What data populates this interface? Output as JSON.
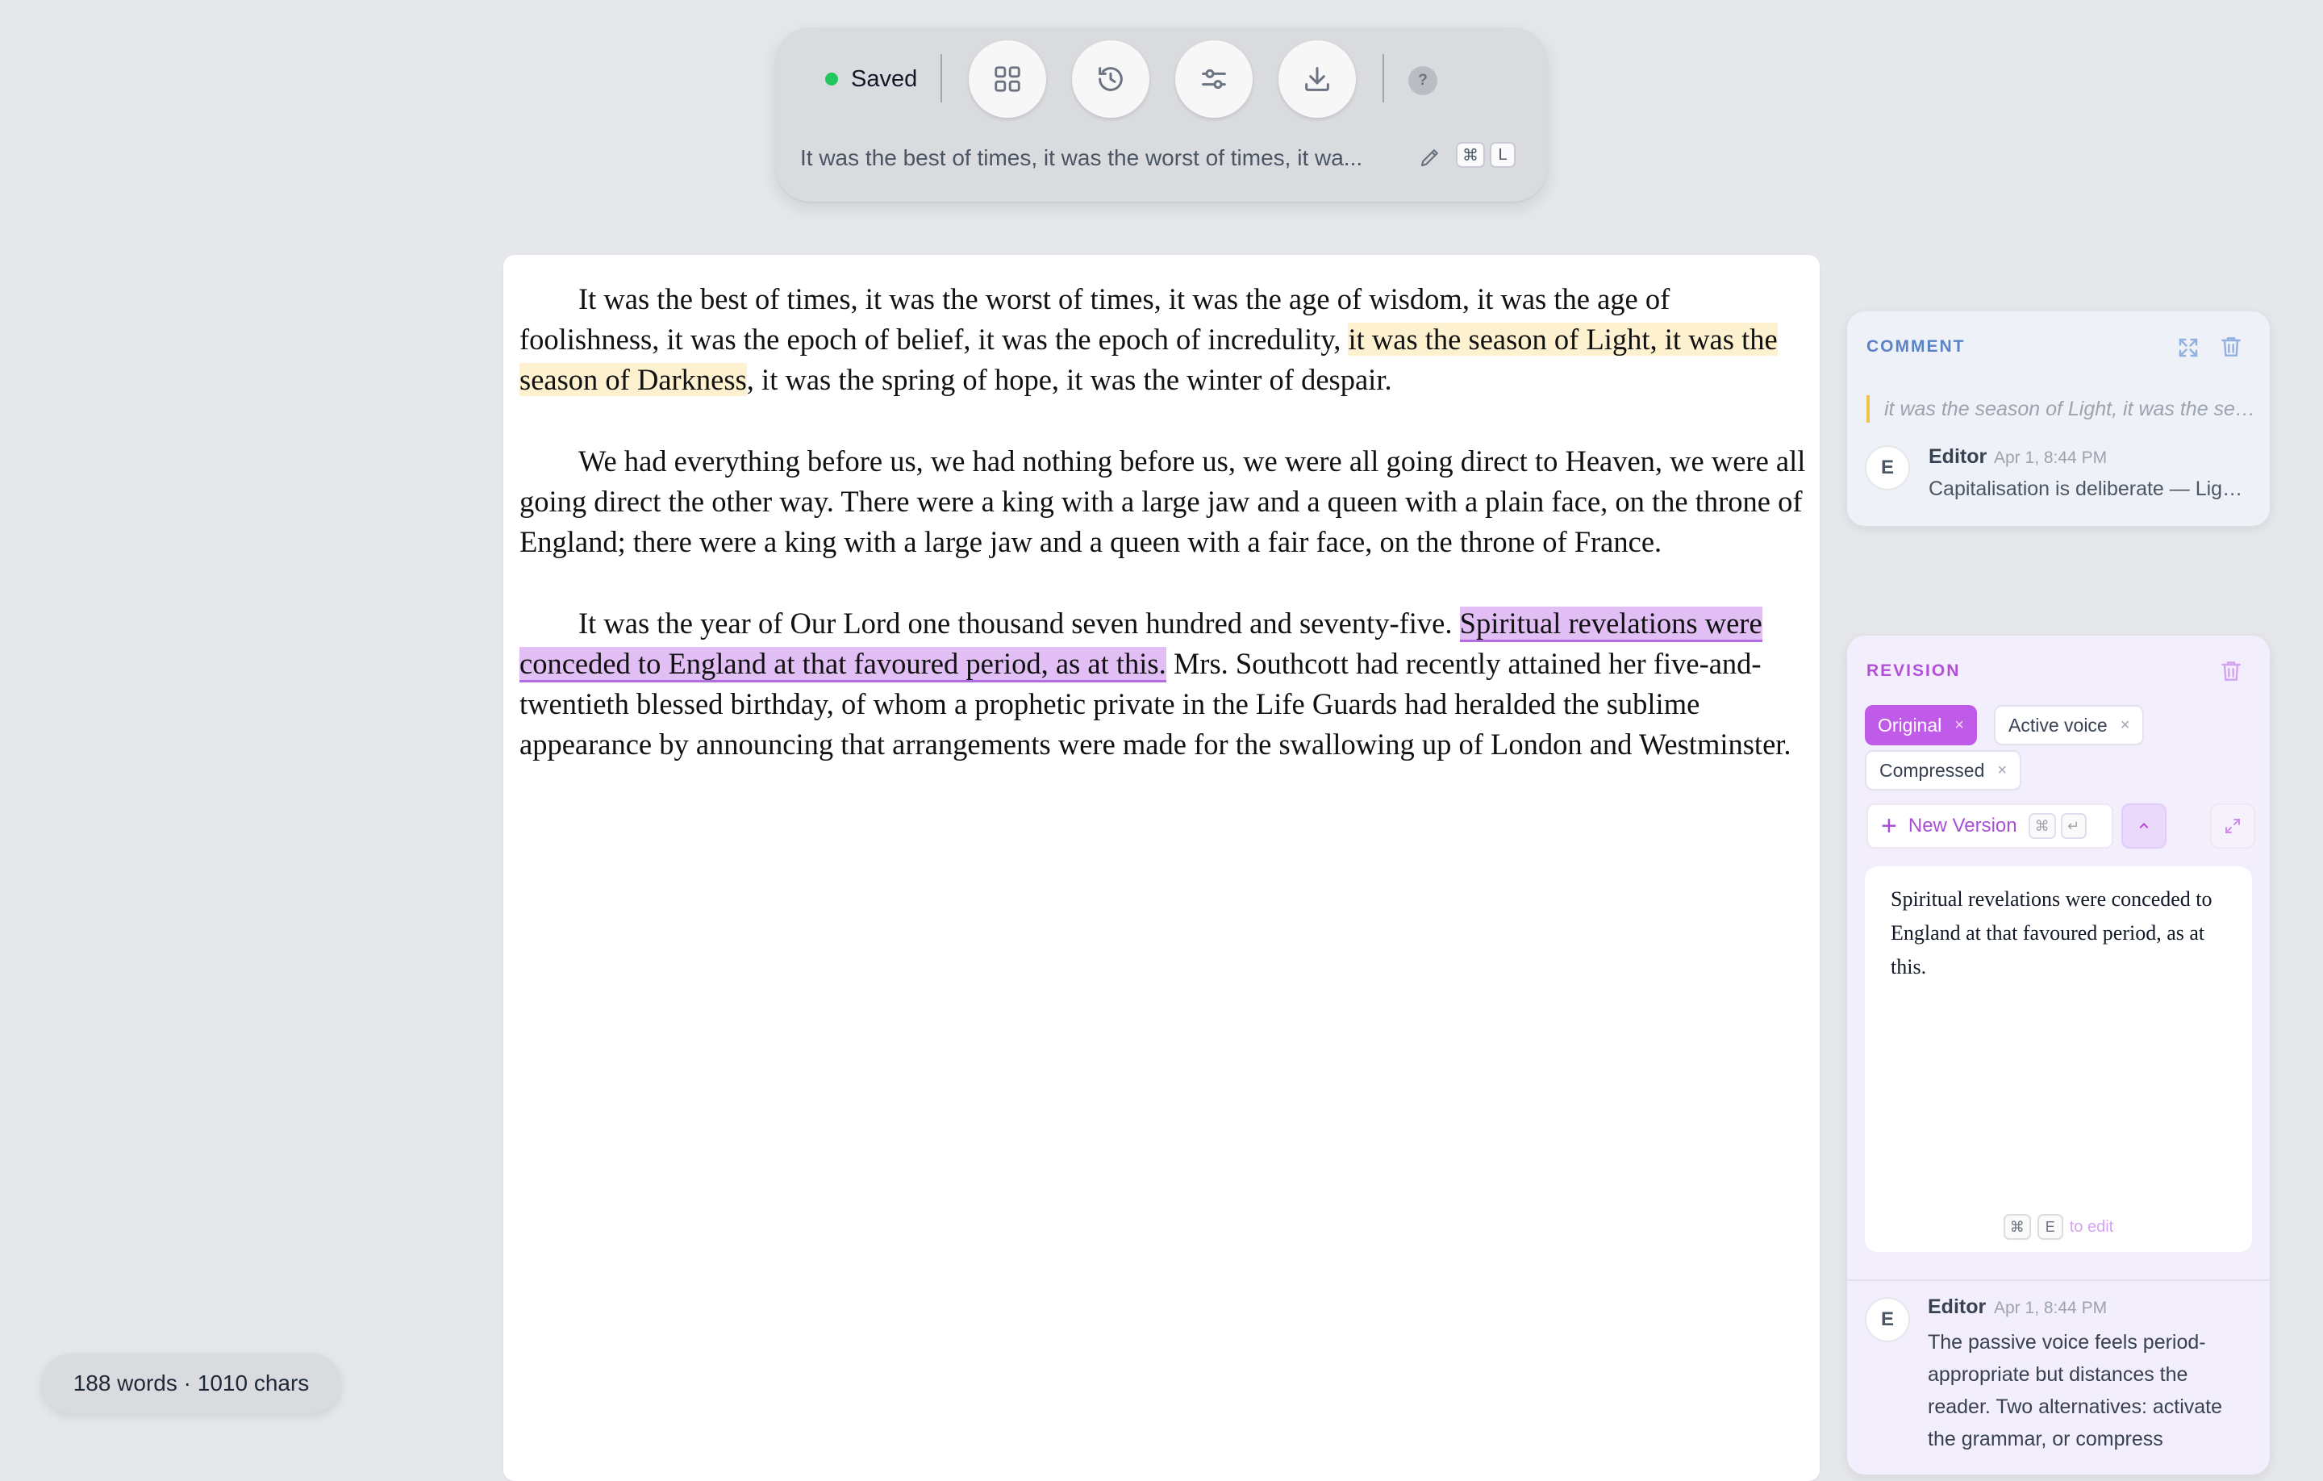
{
  "toolbar": {
    "saved_label": "Saved",
    "doc_title": "It was the best of times, it was the worst of times, it wa...",
    "help_label": "?",
    "shortcut_keys": [
      "⌘",
      "L"
    ],
    "buttons": [
      "grid-icon",
      "history-icon",
      "sliders-icon",
      "download-icon"
    ]
  },
  "document": {
    "p1_a": "It was the best of times, it was the worst of times, it was the age of wisdom, it was the age of foolishness, it was the epoch of belief, it was the epoch of incredulity, ",
    "p1_highlight": "it was the season of Light, it was the season of Darkness",
    "p1_b": ", it was the spring of hope, it was the winter of despair.",
    "p2": "We had everything before us, we had nothing before us, we were all going direct to Heaven, we were all going direct the other way. There were a king with a large jaw and a queen with a plain face, on the throne of England; there were a king with a large jaw and a queen with a fair face, on the throne of France.",
    "p3_a": "It was the year of Our Lord one thousand seven hundred and seventy-five. ",
    "p3_highlight": "Spiritual revelations were conceded to England at that favoured period, as at this.",
    "p3_b": " Mrs. Southcott had recently attained her five-and-twentieth blessed birthday, of whom a prophetic private in the Life Guards had heralded the sublime appearance by announcing that arrangements were made for the swallowing up of London and Westminster."
  },
  "status": {
    "word_count": "188 words · 1010 chars"
  },
  "comment": {
    "heading": "COMMENT",
    "quote": "it was the season of Light, it was the season of Darkness",
    "avatar": "E",
    "author": "Editor",
    "timestamp": "Apr 1, 8:44 PM",
    "text": "Capitalisation is deliberate — Light and Darkness"
  },
  "revision": {
    "heading": "REVISION",
    "versions": [
      {
        "label": "Original",
        "active": true
      },
      {
        "label": "Active voice",
        "active": false
      },
      {
        "label": "Compressed",
        "active": false
      }
    ],
    "chip_close": "×",
    "new_version_label": "New Version",
    "new_version_keys": [
      "⌘",
      "↵"
    ],
    "editor_text": "Spiritual revelations were conceded to England at that favoured period, as at this.",
    "edit_keys": [
      "⌘",
      "E"
    ],
    "edit_hint": "to edit",
    "comment": {
      "avatar": "E",
      "author": "Editor",
      "timestamp": "Apr 1, 8:44 PM",
      "text": "The passive voice feels period-appropriate but distances the reader. Two alternatives: activate the grammar, or compress"
    }
  },
  "colors": {
    "accent_purple": "#c05ae8",
    "comment_blue": "#5b82c4",
    "comment_highlight": "#fdf1cf",
    "revision_highlight": "#e1bff5",
    "saved_green": "#22c55e"
  }
}
